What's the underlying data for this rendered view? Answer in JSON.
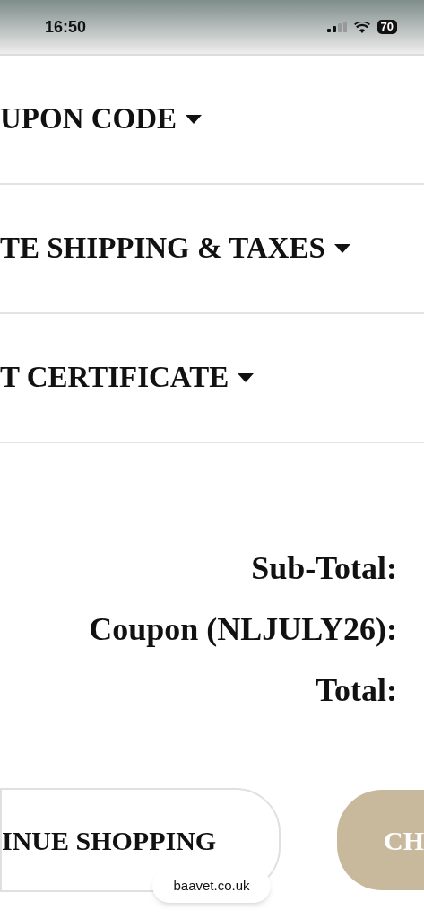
{
  "status_bar": {
    "time": "16:50",
    "battery": "70"
  },
  "accordions": [
    {
      "label": "UPON CODE"
    },
    {
      "label": "TE SHIPPING & TAXES"
    },
    {
      "label": "T CERTIFICATE"
    }
  ],
  "totals": [
    "Sub-Total:",
    "Coupon (NLJULY26):",
    "Total:"
  ],
  "buttons": {
    "continue": "INUE SHOPPING",
    "checkout": "CH"
  },
  "browser": {
    "url": "baavet.co.uk"
  }
}
